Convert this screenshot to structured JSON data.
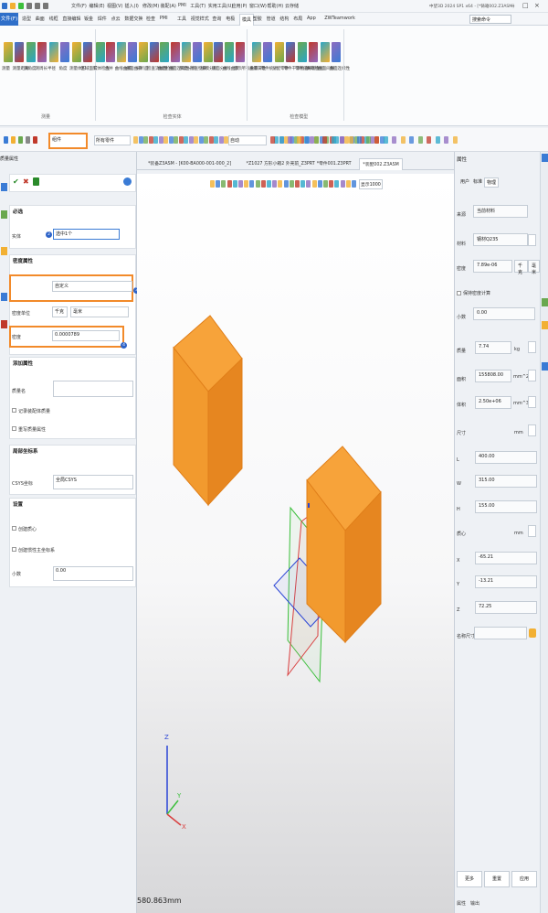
{
  "titlebar": {
    "menus": [
      "文件(F)",
      "编辑(E)",
      "视图(V)",
      "插入(I)",
      "修改(M)",
      "装配(A)",
      "PMI",
      "工具(T)",
      "实用工具(U)",
      "应用(P)",
      "窗口(W)",
      "帮助(H)",
      "云存储"
    ],
    "title": "中望3D 2024 SP1 x64 - [*铸箱002.Z3ASM]"
  },
  "tabs": {
    "file": "文件(F)",
    "items": [
      "造型",
      "曲面",
      "线框",
      "直接编辑",
      "钣金",
      "焊件",
      "点云",
      "数据交换",
      "检查",
      "PMI",
      "工具",
      "视觉样式",
      "查询",
      "电极",
      "模具",
      "塑胶",
      "管道",
      "结构",
      "布局",
      "App",
      "ZWTeamwork"
    ],
    "active_index": 14,
    "search_placeholder": "搜索命令"
  },
  "ribbon": {
    "groups": [
      {
        "label": "测量",
        "buttons": [
          "测量",
          "测量距离",
          "测角度",
          "测周长",
          "半径",
          "角度",
          "测量体积",
          "区域面积"
        ]
      },
      {
        "label": "检查实体",
        "buttons": [
          "实体检查",
          "合并",
          "曲线曲率",
          "曲面曲率",
          "分析面",
          "检查流动性",
          "曲面检查",
          "曲面连续性",
          "厚度分析",
          "检查壁厚",
          "拔模分析",
          "底面分析",
          "曲线曲率",
          "显示所有曲率"
        ]
      },
      {
        "label": "检查模型",
        "buttons": [
          "质量属性",
          "零件统计",
          "分配零件",
          "零件干涉检查",
          "零件间隙检查",
          "关联检查",
          "曲面间隙",
          "曲面连续性"
        ]
      }
    ]
  },
  "toolbar": {
    "filter": "组件",
    "filter2": "所有零件",
    "direction": "自动"
  },
  "left_panel": {
    "tab_label": "质量属性",
    "sections": {
      "required": {
        "title": "必选",
        "target_label": "实体",
        "target_value": "选中1个"
      },
      "density": {
        "title": "密度属性",
        "type_label": "类型",
        "type_value": "自定义",
        "unit_label": "密度单位",
        "unit_a": "千克",
        "unit_b": "毫米",
        "density_label": "密度",
        "density_value": "0.0000789"
      },
      "add_attr": {
        "title": "添加属性",
        "name_label": "质量名",
        "check1": "记录装配体质量",
        "check2": "重写质量属性"
      },
      "coord": {
        "title": "局部坐标系",
        "csys_label": "CSYS坐标",
        "csys_value": "全局CSYS"
      },
      "settings": {
        "title": "设置",
        "check1": "创建质心",
        "check2": "创建惯性主坐标系",
        "decimal_label": "小数",
        "decimal_value": "0.00"
      }
    },
    "badges": [
      "1",
      "2",
      "3",
      "4"
    ]
  },
  "doc_tabs": [
    {
      "label": "*装备Z3ASM - [K00-BA000-001-000_2]",
      "active": false
    },
    {
      "label": "*Z1027 方形小箱2 外壳前_Z3PRT",
      "active": false
    },
    {
      "label": "*零件001.Z3PRT",
      "active": false
    },
    {
      "label": "*装配002.Z3ASM",
      "active": true
    }
  ],
  "viewport": {
    "zoom_label": "显示1000",
    "scale_text": "580.863mm",
    "axis_x": "X",
    "axis_y": "Y",
    "axis_z": "Z"
  },
  "right_panel": {
    "title": "属性",
    "tabs": [
      "用户",
      "标准",
      "物理"
    ],
    "active_tab": "物理",
    "source_label": "来源",
    "source_value": "当前材料",
    "material_label": "材料",
    "material_value": "钢材Q235",
    "density_label": "密度",
    "density_value": "7.89e-06",
    "density_unit_a": "千克",
    "density_unit_b": "毫米",
    "keep_checkbox": "保持密度计算",
    "decimal_label": "小数",
    "decimal_value": "0.00",
    "mass_label": "质量",
    "mass_value": "7.74",
    "mass_unit": "kg",
    "area_label": "面积",
    "area_value": "155808.00",
    "area_unit": "mm^2",
    "volume_label": "体积",
    "volume_value": "2.50e+06",
    "volume_unit": "mm^3",
    "size_label": "尺寸",
    "size_unit": "mm",
    "L_label": "L",
    "L_value": "400.00",
    "W_label": "W",
    "W_value": "315.00",
    "H_label": "H",
    "H_value": "155.00",
    "centroid_label": "质心",
    "centroid_unit": "mm",
    "X_label": "X",
    "X_value": "-65.21",
    "Y_label": "Y",
    "Y_value": "-13.21",
    "Z_label": "Z",
    "Z_value": "72.25",
    "override_label": "名称尺寸",
    "buttons": [
      "更多",
      "重置",
      "应用"
    ],
    "bottom_tabs": [
      "属性",
      "输出"
    ]
  }
}
